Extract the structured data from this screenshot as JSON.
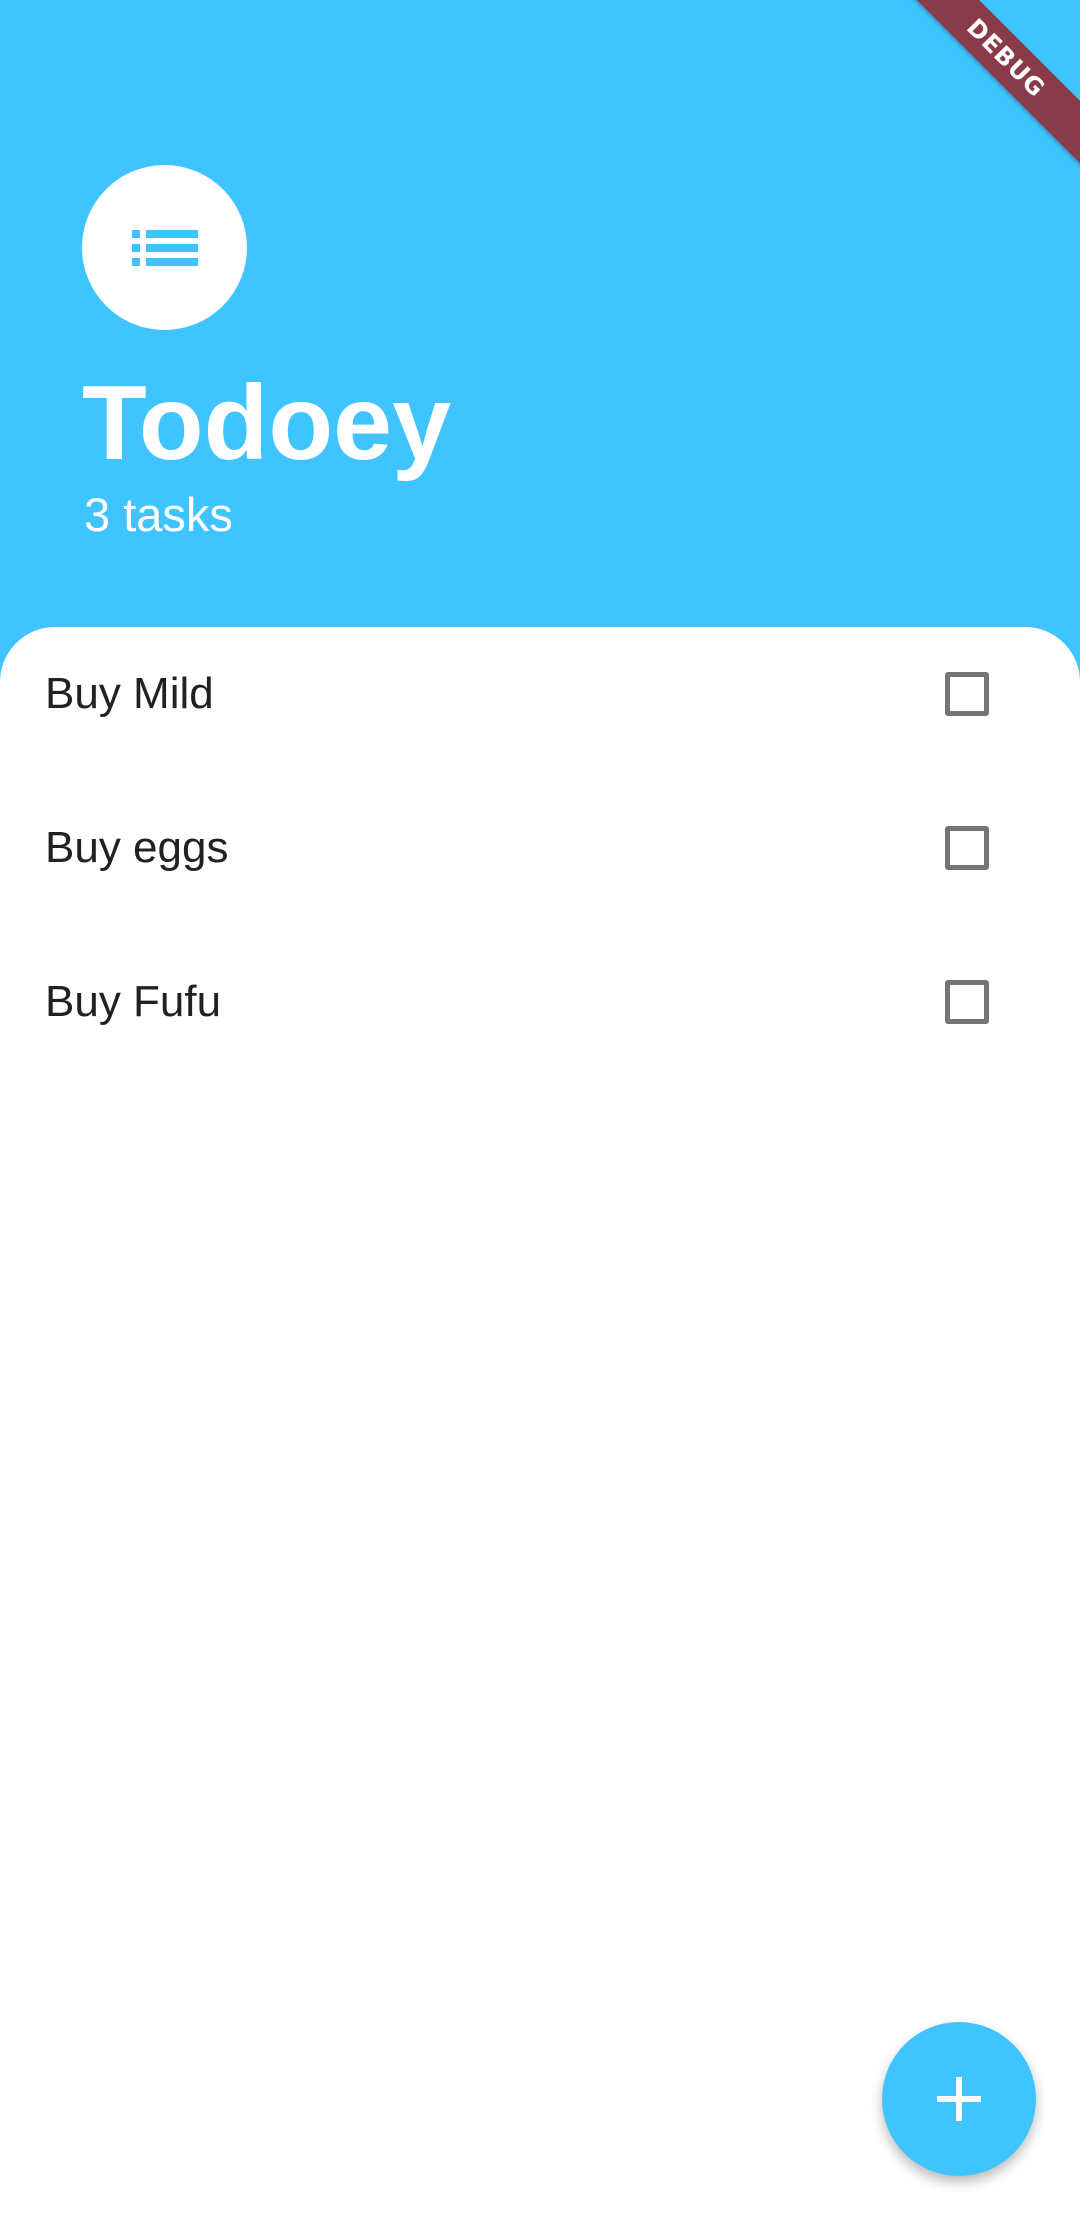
{
  "app": {
    "title": "Todoey",
    "task_count_text": "3 tasks",
    "debug_banner": "DEBUG",
    "header_icon": "list-icon",
    "accent_color": "#40C4FF"
  },
  "tasks": [
    {
      "name": "Buy Mild",
      "checked": false
    },
    {
      "name": "Buy eggs",
      "checked": false
    },
    {
      "name": "Buy Fufu",
      "checked": false
    }
  ],
  "fab": {
    "icon": "add-icon"
  }
}
